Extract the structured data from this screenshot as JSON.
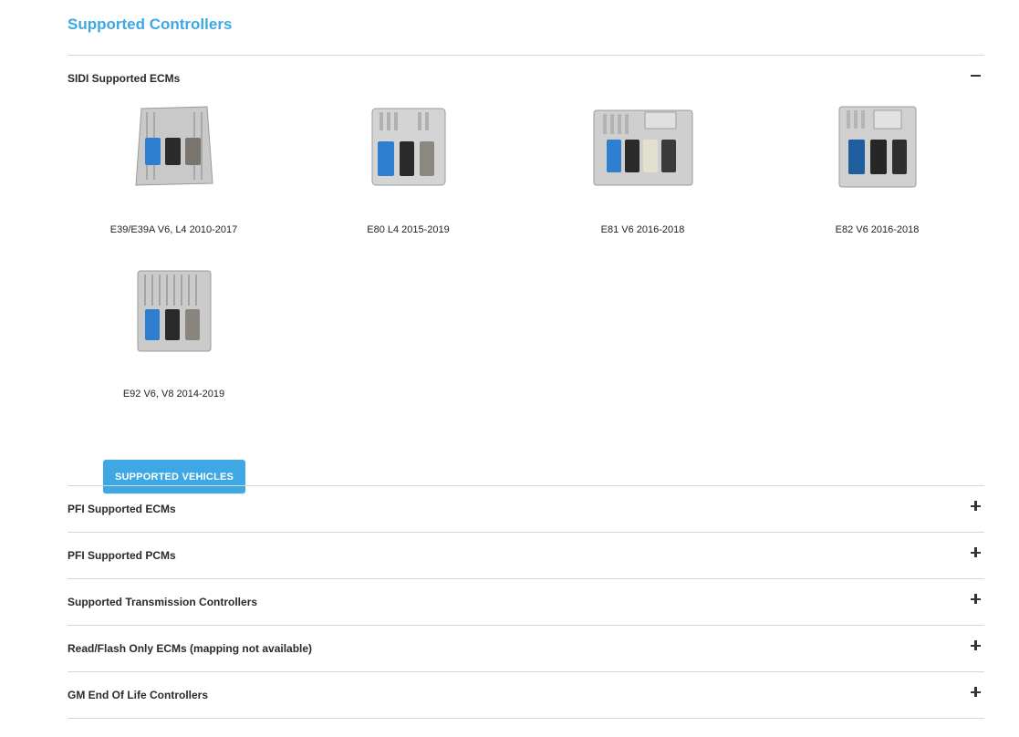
{
  "page": {
    "title": "Supported Controllers"
  },
  "sections": [
    {
      "title": "SIDI Supported ECMs",
      "expanded": true,
      "items": [
        {
          "label": "E39/E39A V6, L4 2010-2017",
          "icon": "ecm-module-image"
        },
        {
          "label": "E80 L4 2015-2019",
          "icon": "ecm-module-image"
        },
        {
          "label": "E81 V6 2016-2018",
          "icon": "ecm-module-image"
        },
        {
          "label": "E82 V6 2016-2018",
          "icon": "ecm-module-image"
        },
        {
          "label": "E92 V6, V8 2014-2019",
          "icon": "ecm-module-image"
        }
      ],
      "button_label": "SUPPORTED VEHICLES"
    },
    {
      "title": "PFI Supported ECMs",
      "expanded": false
    },
    {
      "title": "PFI Supported PCMs",
      "expanded": false
    },
    {
      "title": "Supported Transmission Controllers",
      "expanded": false
    },
    {
      "title": "Read/Flash Only ECMs (mapping not available)",
      "expanded": false
    },
    {
      "title": "GM End Of Life Controllers",
      "expanded": false
    }
  ],
  "colors": {
    "accent": "#3ea8e4",
    "divider": "#d6d6d6",
    "connector_blue": "#2f7fd0"
  }
}
